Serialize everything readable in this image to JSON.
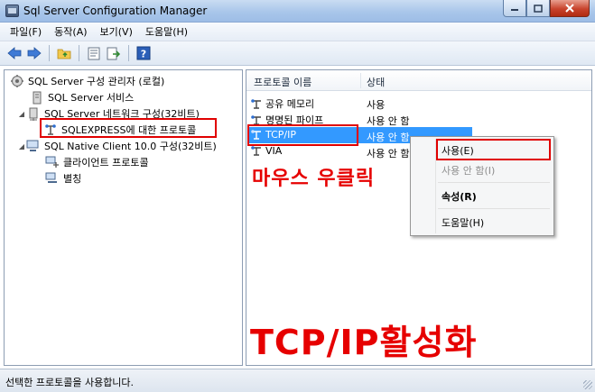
{
  "window": {
    "title": "Sql Server Configuration Manager"
  },
  "menu": [
    "파일(F)",
    "동작(A)",
    "보기(V)",
    "도움말(H)"
  ],
  "toolbar": {
    "buttons": [
      "back-icon",
      "forward-icon",
      "folder-up-icon",
      "properties-icon",
      "export-icon",
      "help-icon"
    ]
  },
  "tree": {
    "root": "SQL Server 구성 관리자 (로컬)",
    "services": "SQL Server 서비스",
    "network": "SQL Server 네트워크 구성(32비트)",
    "express": "SQLEXPRESS에 대한 프로토콜",
    "native": "SQL Native Client 10.0 구성(32비트)",
    "client_protocols": "클라이언트 프로토콜",
    "aliases": "별칭"
  },
  "list": {
    "col_name": "프로토콜 이름",
    "col_state": "상태",
    "rows": [
      {
        "name": "공유 메모리",
        "state": "사용"
      },
      {
        "name": "명명된 파이프",
        "state": "사용 안 함"
      },
      {
        "name": "TCP/IP",
        "state": "사용 안 함"
      },
      {
        "name": "VIA",
        "state": "사용 안 함"
      }
    ]
  },
  "context_menu": {
    "enable": "사용(E)",
    "disable": "사용 안 함(I)",
    "properties": "속성(R)",
    "help": "도움말(H)"
  },
  "annotations": {
    "right_click": "마우스 우클릭",
    "enable_tcpip": "TCP/IP활성화"
  },
  "status": {
    "text": "선택한 프로토콜을 사용합니다."
  },
  "colors": {
    "annotation": "#e60000",
    "selection": "#3399ff"
  }
}
